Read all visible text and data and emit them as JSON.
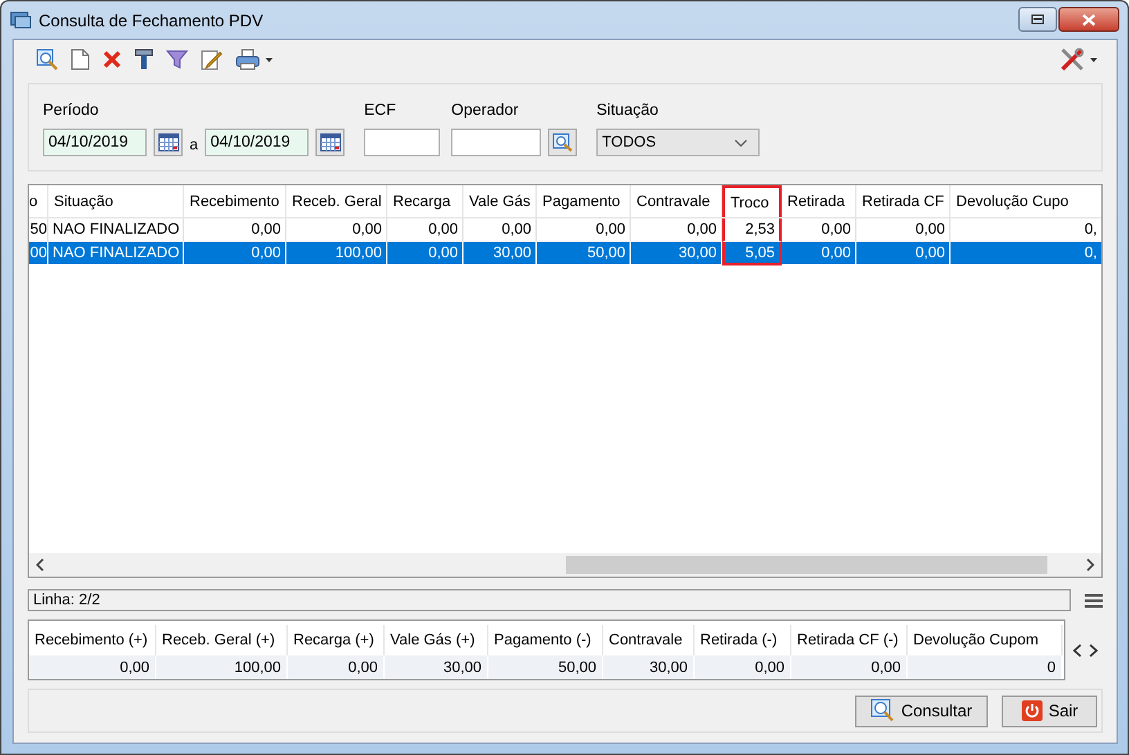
{
  "window": {
    "title": "Consulta de Fechamento PDV"
  },
  "filters": {
    "periodo_label": "Período",
    "date_from": "04/10/2019",
    "separator": "a",
    "date_to": "04/10/2019",
    "ecf_label": "ECF",
    "operador_label": "Operador",
    "situacao_label": "Situação",
    "situacao_value": "TODOS"
  },
  "grid": {
    "columns": [
      {
        "label": "o",
        "highlighted": false
      },
      {
        "label": "Situação",
        "highlighted": false
      },
      {
        "label": "Recebimento",
        "highlighted": false
      },
      {
        "label": "Receb. Geral",
        "highlighted": false
      },
      {
        "label": "Recarga",
        "highlighted": false
      },
      {
        "label": "Vale Gás",
        "highlighted": false
      },
      {
        "label": "Pagamento",
        "highlighted": false
      },
      {
        "label": "Contravale",
        "highlighted": false
      },
      {
        "label": "Troco",
        "highlighted": true
      },
      {
        "label": "Retirada",
        "highlighted": false
      },
      {
        "label": "Retirada CF",
        "highlighted": false
      },
      {
        "label": "Devolução Cupo",
        "highlighted": false
      }
    ],
    "rows": [
      {
        "selected": false,
        "cells": [
          "50",
          "NAO FINALIZADO",
          "0,00",
          "0,00",
          "0,00",
          "0,00",
          "0,00",
          "0,00",
          "2,53",
          "0,00",
          "0,00",
          "0,"
        ]
      },
      {
        "selected": true,
        "cells": [
          "00",
          "NAO FINALIZADO",
          "0,00",
          "100,00",
          "0,00",
          "30,00",
          "50,00",
          "30,00",
          "5,05",
          "0,00",
          "0,00",
          "0,"
        ]
      }
    ]
  },
  "status": "Linha: 2/2",
  "totals": [
    {
      "label": "Recebimento (+)",
      "value": "0,00"
    },
    {
      "label": "Receb. Geral (+)",
      "value": "100,00"
    },
    {
      "label": "Recarga (+)",
      "value": "0,00"
    },
    {
      "label": "Vale Gás (+)",
      "value": "30,00"
    },
    {
      "label": "Pagamento (-)",
      "value": "50,00"
    },
    {
      "label": "Contravale",
      "value": "30,00"
    },
    {
      "label": "Retirada (-)",
      "value": "0,00"
    },
    {
      "label": "Retirada CF (-)",
      "value": "0,00"
    },
    {
      "label": "Devolução Cupom",
      "value": "0"
    }
  ],
  "buttons": [
    {
      "label": "Consultar",
      "kind": "search"
    },
    {
      "label": "Sair",
      "kind": "exit"
    }
  ]
}
